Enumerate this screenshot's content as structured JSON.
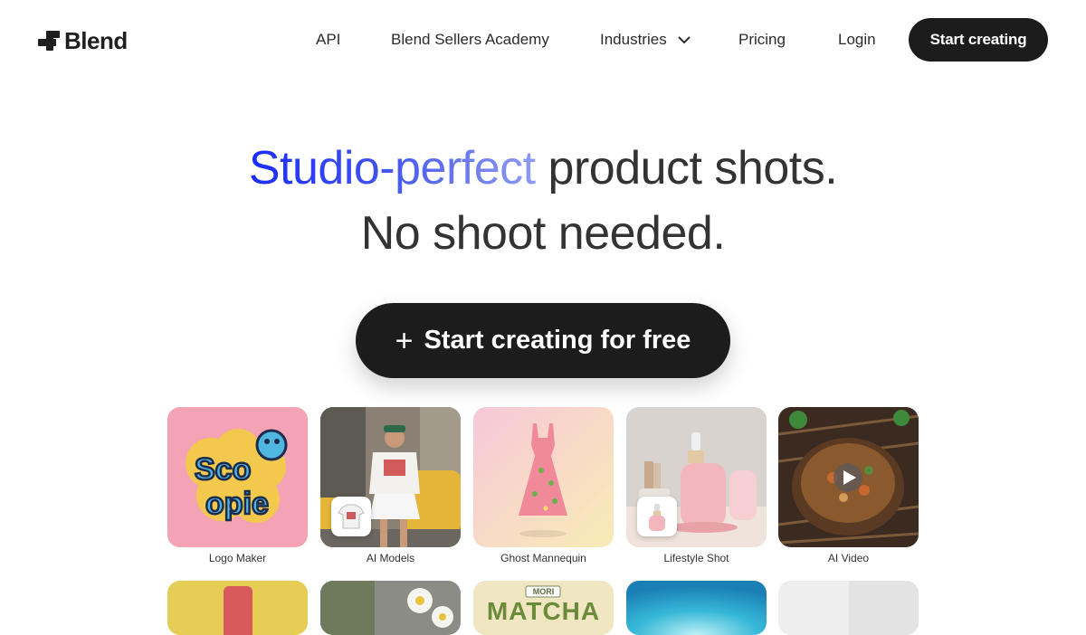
{
  "brand": {
    "name": "Blend"
  },
  "nav": {
    "links": [
      {
        "label": "API"
      },
      {
        "label": "Blend Sellers Academy"
      },
      {
        "label": "Industries"
      },
      {
        "label": "Pricing"
      },
      {
        "label": "Login"
      }
    ],
    "cta": "Start creating"
  },
  "hero": {
    "headline_highlight": "Studio-perfect",
    "headline_rest": "product shots.",
    "subline": "No shoot needed.",
    "cta_plus": "+",
    "cta_label": "Start creating for free"
  },
  "tools": [
    {
      "label": "Logo Maker",
      "logo_text_1": "Sco",
      "logo_text_2": "opie"
    },
    {
      "label": "AI Models"
    },
    {
      "label": "Ghost Mannequin"
    },
    {
      "label": "Lifestyle Shot"
    },
    {
      "label": "AI Video"
    }
  ],
  "row2": {
    "matcha_brand": "MORI",
    "matcha_text": "MATCHA"
  },
  "colors": {
    "accent_gradient_start": "#1a2cff",
    "accent_gradient_end": "#8f9bf2",
    "button_dark": "#1c1c1c"
  }
}
